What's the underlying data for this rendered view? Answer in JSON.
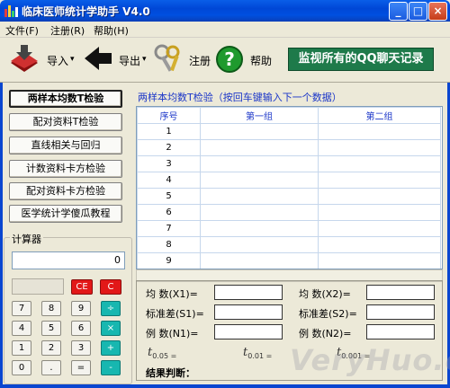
{
  "window": {
    "title": "临床医师统计学助手 V4.0",
    "minimize_glyph": "_",
    "maximize_glyph": "□",
    "close_glyph": "×"
  },
  "menu": [
    "文件(F)",
    "注册(R)",
    "帮助(H)"
  ],
  "toolbar": {
    "import_label": "导入",
    "export_label": "导出",
    "register_label": "注册",
    "help_label": "帮助",
    "dropdown_glyph": "▾",
    "help_glyph": "?",
    "banner": "监视所有的QQ聊天记录"
  },
  "left_menu": [
    "两样本均数T检验",
    "配对资料T检验",
    "直线相关与回归",
    "计数资料卡方检验",
    "配对资料卡方检验",
    "医学统计学傻瓜教程"
  ],
  "calculator": {
    "title": "计算器",
    "display": "0",
    "ce_label": "CE",
    "c_label": "C",
    "keys": [
      [
        "7",
        "8",
        "9",
        "÷"
      ],
      [
        "4",
        "5",
        "6",
        "×"
      ],
      [
        "1",
        "2",
        "3",
        "+"
      ],
      [
        "0",
        ".",
        "=",
        "-"
      ]
    ]
  },
  "hint": "两样本均数T检验（按回车键输入下一个数据）",
  "grid": {
    "headers": [
      "序号",
      "第一组",
      "第二组"
    ],
    "rows": [
      "1",
      "2",
      "3",
      "4",
      "5",
      "6",
      "7",
      "8",
      "9"
    ]
  },
  "results": {
    "mean1": "均  数(X1)=",
    "mean2": "均  数(X2)=",
    "sd1": "标准差(S1)=",
    "sd2": "标准差(S2)=",
    "n1": "例  数(N1)=",
    "n2": "例  数(N2)=",
    "t_symbol": "t",
    "t005": "0.05 =",
    "t001": "0.01 =",
    "t0001": "0.001 =",
    "conclusion": "结果判断："
  },
  "watermark": "VeryHuo.com",
  "colors": {
    "titlebar": "#0a5ee8",
    "banner_bg": "#1e7a4a",
    "hint_text": "#1a35c8",
    "calc_red": "#e21818",
    "calc_teal": "#17b7b0"
  }
}
